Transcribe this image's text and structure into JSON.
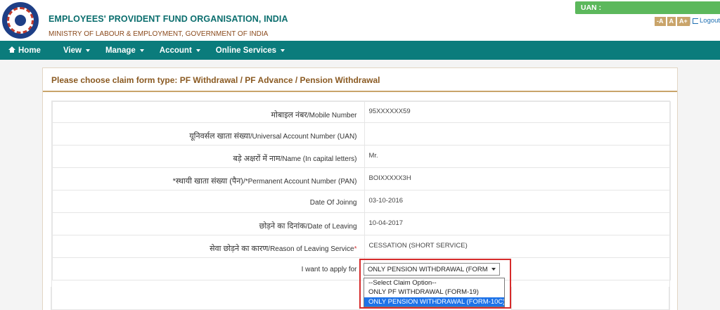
{
  "header": {
    "org_title": "EMPLOYEES' PROVIDENT FUND ORGANISATION, INDIA",
    "org_subtitle": "MINISTRY OF LABOUR & EMPLOYMENT, GOVERNMENT OF INDIA",
    "uan_label": "UAN :",
    "font_small": "-A",
    "font_normal": "A",
    "font_large": "A+",
    "logout": "Logout"
  },
  "nav": {
    "items": [
      "Home",
      "View",
      "Manage",
      "Account",
      "Online Services"
    ]
  },
  "panel": {
    "title": "Please choose claim form type: PF Withdrawal / PF Advance / Pension Withdrawal"
  },
  "form": {
    "rows": [
      {
        "label_hi": "मोबाइल नंबर",
        "label_en": "/Mobile Number",
        "value": "95XXXXXX59"
      },
      {
        "label_hi": "यूनिवर्सल खाता संख्या",
        "label_en": "/Universal Account Number (UAN)",
        "value": ""
      },
      {
        "label_hi": "बड़े अक्षरों में नाम",
        "label_en": "/Name (In capital letters)",
        "value": "Mr."
      },
      {
        "label_hi": "*स्थायी खाता संख्या (पैन)",
        "label_en": "/*Permanent Account Number (PAN)",
        "value": "BOIXXXXX3H"
      },
      {
        "label_hi": "",
        "label_en": "Date Of Joinng",
        "value": "03-10-2016"
      },
      {
        "label_hi": "छोड़ने का दिनांक",
        "label_en": "/Date of Leaving",
        "value": "10-04-2017"
      },
      {
        "label_hi": "सेवा छोड़ने का कारण",
        "label_en": "/Reason of Leaving Service",
        "required": "*",
        "value": "CESSATION (SHORT SERVICE)"
      }
    ],
    "apply_label": "I want to apply for",
    "select_value": "ONLY PENSION WITHDRAWAL (FORM-10C)",
    "options": [
      "--Select Claim Option--",
      "ONLY PF WITHDRAWAL (FORM-19)",
      "ONLY PENSION WITHDRAWAL (FORM-10C)"
    ],
    "selected_index": 2
  },
  "colors": {
    "nav_bg": "#0b7c7c",
    "title_teal": "#0b6e6e",
    "uan_green": "#5cb85c",
    "highlight_red": "#d62b2b",
    "option_selected": "#1e73e8"
  }
}
